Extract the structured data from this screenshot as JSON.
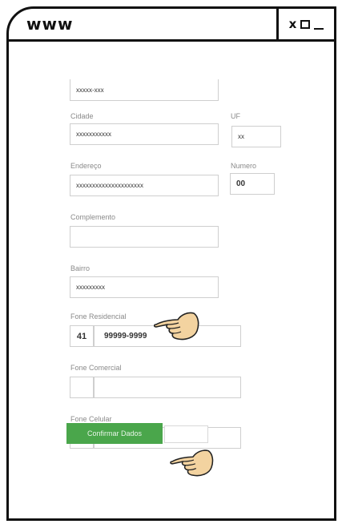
{
  "window": {
    "title": "www",
    "controls": {
      "close": "x"
    }
  },
  "form": {
    "cep": {
      "value": "xxxxx-xxx"
    },
    "cidade": {
      "label": "Cidade",
      "value": "xxxxxxxxxxx"
    },
    "uf": {
      "label": "UF",
      "value": "xx"
    },
    "endereco": {
      "label": "Endereço",
      "value": "xxxxxxxxxxxxxxxxxxxxx"
    },
    "numero": {
      "label": "Numero",
      "value": "00"
    },
    "complemento": {
      "label": "Complemento",
      "value": ""
    },
    "bairro": {
      "label": "Bairro",
      "value": "xxxxxxxxx"
    },
    "fone_residencial": {
      "label": "Fone Residencial",
      "ddd": "41",
      "number": "99999-9999"
    },
    "fone_comercial": {
      "label": "Fone Comercial",
      "ddd": "",
      "number": ""
    },
    "fone_celular": {
      "label": "Fone Celular",
      "ddd": "",
      "number": ""
    },
    "confirm_label": "Confirmar Dados"
  },
  "icons": {
    "pointer": "pointing-hand-icon"
  },
  "colors": {
    "button": "#4aa64b",
    "pointer": "#f3d3a0",
    "frame": "#111111"
  }
}
